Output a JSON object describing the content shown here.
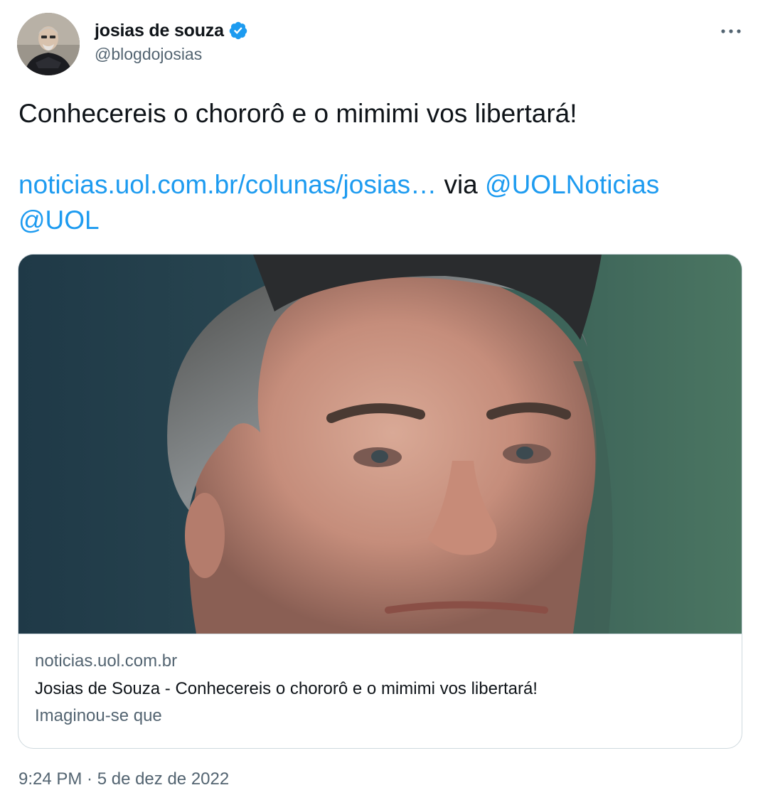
{
  "author": {
    "name": "josias de souza",
    "handle": "@blogdojosias",
    "verified": true,
    "avatar_icon": "profile-photo"
  },
  "menu": {
    "more_icon": "ellipsis-icon"
  },
  "tweet": {
    "text": "Conhecereis o chororô e o mimimi vos libertará!",
    "link_url": "noticias.uol.com.br/colunas/josias…",
    "via_text": "via",
    "mention_1": "@UOLNoticias",
    "mention_2": "@UOL"
  },
  "card": {
    "image": "photo-of-man-close-up",
    "domain": "noticias.uol.com.br",
    "title": "Josias de Souza - Conhecereis o chororô e o mimimi vos libertará!",
    "description": "Imaginou-se que"
  },
  "timestamp": "9:24 PM · 5 de dez de 2022",
  "colors": {
    "link": "#1d9bf0",
    "text": "#0f1419",
    "secondary": "#536471",
    "border": "#cfd9de"
  }
}
